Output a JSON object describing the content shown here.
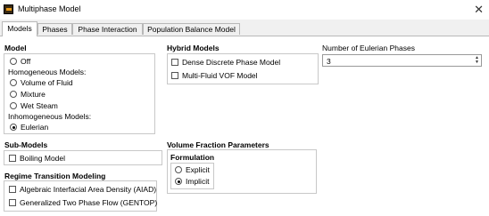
{
  "window": {
    "title": "Multiphase Model",
    "close_glyph": "✕"
  },
  "tabs": [
    {
      "label": "Models"
    },
    {
      "label": "Phases"
    },
    {
      "label": "Phase Interaction"
    },
    {
      "label": "Population Balance Model"
    }
  ],
  "model": {
    "heading": "Model",
    "off": "Off",
    "homogeneous_label": "Homogeneous Models:",
    "volume_of_fluid": "Volume of Fluid",
    "mixture": "Mixture",
    "wet_steam": "Wet Steam",
    "inhomogeneous_label": "Inhomogeneous Models:",
    "eulerian": "Eulerian",
    "selected": "Eulerian"
  },
  "hybrid": {
    "heading": "Hybrid Models",
    "dense_dpm": "Dense Discrete Phase Model",
    "multi_fluid_vof": "Multi-Fluid VOF Model"
  },
  "phases": {
    "heading": "Number of Eulerian Phases",
    "value": "3"
  },
  "submodels": {
    "heading": "Sub-Models",
    "boiling": "Boiling Model"
  },
  "vfp": {
    "heading": "Volume Fraction Parameters",
    "formulation": "Formulation",
    "explicit": "Explicit",
    "implicit": "Implicit",
    "selected": "Implicit"
  },
  "regime": {
    "heading": "Regime Transition Modeling",
    "aiad": "Algebraic Interfacial Area Density (AIAD)",
    "gentop": "Generalized Two Phase Flow (GENTOP)"
  }
}
